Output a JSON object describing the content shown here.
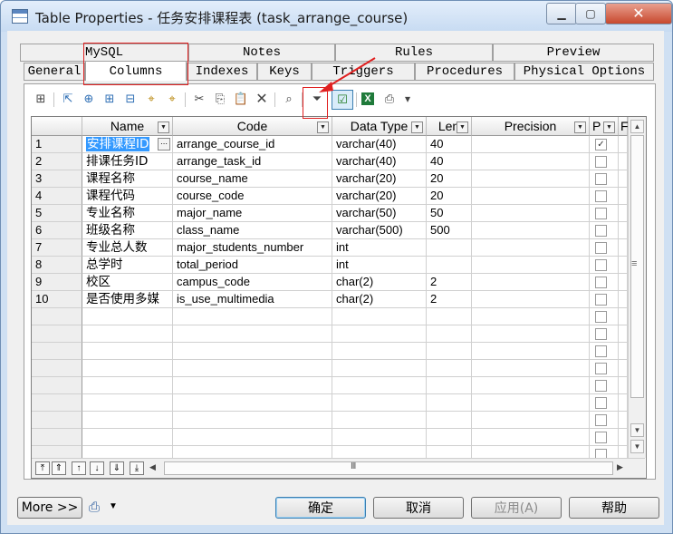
{
  "window": {
    "title": "Table Properties - 任务安排课程表 (task_arrange_course)",
    "minimize_icon": "▁",
    "maximize_icon": "▢",
    "close_icon": "✕"
  },
  "tabs_top": [
    "MySQL",
    "Notes",
    "Rules",
    "Preview"
  ],
  "tabs_bottom": [
    "General",
    "Columns",
    "Indexes",
    "Keys",
    "Triggers",
    "Procedures",
    "Physical Options"
  ],
  "active_tab": "Columns",
  "toolbar": {
    "properties": "⊞",
    "insert": "⇱",
    "add": "⊕",
    "add_rows": "⊞",
    "paste_rows": "⊟",
    "find": "⌖",
    "cut": "✂",
    "copy": "⎘",
    "paste": "📋",
    "delete": "✕",
    "search": "⌕",
    "filter": "⏷",
    "customize": "☑",
    "excel": "X",
    "print": "⎙",
    "more": "▾"
  },
  "grid": {
    "headers": [
      "Name",
      "Code",
      "Data Type",
      "Len",
      "Precision",
      "P",
      "F"
    ],
    "rows": [
      {
        "num": "1",
        "name": "安排课程ID",
        "code": "arrange_course_id",
        "type": "varchar(40)",
        "len": "40",
        "precision": "",
        "p": "✓"
      },
      {
        "num": "2",
        "name": "排课任务ID",
        "code": "arrange_task_id",
        "type": "varchar(40)",
        "len": "40",
        "precision": "",
        "p": ""
      },
      {
        "num": "3",
        "name": "课程名称",
        "code": "course_name",
        "type": "varchar(20)",
        "len": "20",
        "precision": "",
        "p": ""
      },
      {
        "num": "4",
        "name": "课程代码",
        "code": "course_code",
        "type": "varchar(20)",
        "len": "20",
        "precision": "",
        "p": ""
      },
      {
        "num": "5",
        "name": "专业名称",
        "code": "major_name",
        "type": "varchar(50)",
        "len": "50",
        "precision": "",
        "p": ""
      },
      {
        "num": "6",
        "name": "班级名称",
        "code": "class_name",
        "type": "varchar(500)",
        "len": "500",
        "precision": "",
        "p": ""
      },
      {
        "num": "7",
        "name": "专业总人数",
        "code": "major_students_number",
        "type": "int",
        "len": "",
        "precision": "",
        "p": ""
      },
      {
        "num": "8",
        "name": "总学时",
        "code": "total_period",
        "type": "int",
        "len": "",
        "precision": "",
        "p": ""
      },
      {
        "num": "9",
        "name": "校区",
        "code": "campus_code",
        "type": "char(2)",
        "len": "2",
        "precision": "",
        "p": ""
      },
      {
        "num": "10",
        "name": "是否使用多媒",
        "code": "is_use_multimedia",
        "type": "char(2)",
        "len": "2",
        "precision": "",
        "p": ""
      }
    ],
    "empty_rows": 9,
    "nav_buttons": [
      "⤒",
      "⇑",
      "↑",
      "↓",
      "⇓",
      "⤓"
    ],
    "hscroll_thumb": "III",
    "scroll_up": "▲",
    "scroll_down": "▼",
    "scroll_lines": "≡",
    "scroll_left": "◀",
    "scroll_right": "▶"
  },
  "buttons": {
    "more": "More >>",
    "print_icon": "⎙",
    "ok": "确定",
    "cancel": "取消",
    "apply": "应用(A)",
    "help": "帮助"
  }
}
